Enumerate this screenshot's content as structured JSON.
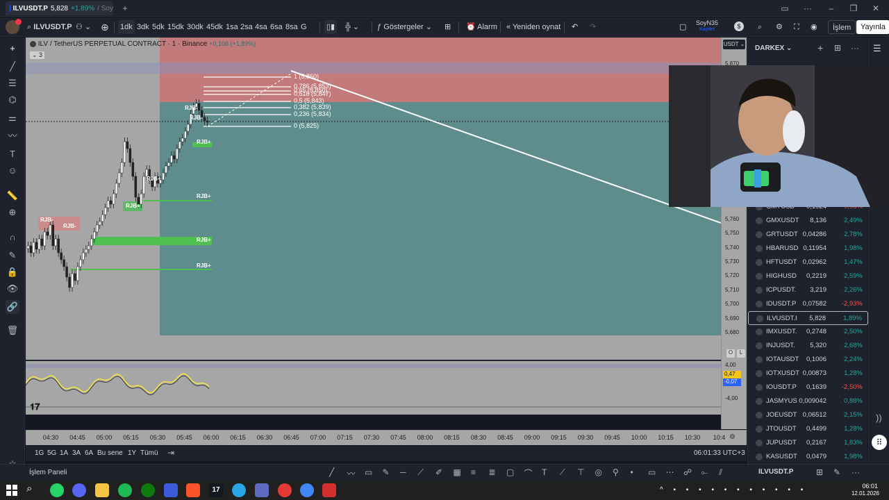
{
  "titlebar": {
    "tab_symbol": "ILVUSDT.P",
    "tab_price": "5,828",
    "tab_change": "+1.89%",
    "tab_rest": "/ Soy"
  },
  "toolbar": {
    "symbol": "ILVUSDT.P",
    "intervals": [
      "1dk",
      "3dk",
      "5dk",
      "15dk",
      "30dk",
      "45dk",
      "1sa",
      "2sa",
      "4sa",
      "6sa",
      "8sa",
      "G"
    ],
    "active_interval": "1dk",
    "indicators_label": "Göstergeler",
    "alarm_label": "Alarm",
    "replay_label": "Yeniden oynat",
    "layout_name": "SoyN35",
    "layout_saved": "Kaydet",
    "trade_label": "İşlem",
    "publish_label": "Yayınla"
  },
  "chart": {
    "legend": "ILV / TetherUS PERPETUAL CONTRACT · 1 · Binance",
    "legend_change": "+0,108 (+1,89%)",
    "legend_count": "3",
    "currency": "USDT",
    "price_ticks": [
      "5,870",
      "5,760",
      "5,750",
      "5,740",
      "5,730",
      "5,720",
      "5,710",
      "5,700",
      "5,690",
      "5,680"
    ],
    "osc_ticks": [
      "4,00",
      "-4,00"
    ],
    "osc_values": [
      "0,47",
      "-0,07"
    ],
    "time_ticks": [
      "04:30",
      "04:45",
      "05:00",
      "05:15",
      "05:30",
      "05:45",
      "06:00",
      "06:15",
      "06:30",
      "06:45",
      "07:00",
      "07:15",
      "07:30",
      "07:45",
      "08:00",
      "08:15",
      "08:30",
      "08:45",
      "09:00",
      "09:15",
      "09:30",
      "09:45",
      "10:00",
      "10:15",
      "10:30",
      "10:4"
    ],
    "fib_levels": [
      "1 (5,860)",
      "0,786 (5,853)",
      "0,65 (5,850)",
      "0,618 (5,847)",
      "0,5 (5,843)",
      "0,382 (5,839)",
      "0,236 (5,834)",
      "0 (5,825)"
    ],
    "rjb_labels": [
      "RJB+",
      "RJB+",
      "RJB+",
      "RJB+",
      "RJB-",
      "RJB-",
      "RJB-",
      "RJB+",
      "RJB+",
      "RJB-"
    ]
  },
  "bottombar": {
    "ranges": [
      "1G",
      "5G",
      "1A",
      "3A",
      "6A",
      "Bu sene",
      "1Y",
      "Tümü"
    ],
    "clock": "06:01:33 UTC+3"
  },
  "panel": {
    "label": "İşlem Paneli",
    "symbol": "ILVUSDT.P"
  },
  "watchlist": {
    "title": "DARKEX",
    "rows": [
      {
        "symbol": "GMTUSD",
        "price": "0,1924",
        "change": "-0,98%",
        "dir": "neg"
      },
      {
        "symbol": "GMXUSDT",
        "price": "8,136",
        "change": "2,49%",
        "dir": "pos"
      },
      {
        "symbol": "GRTUSDT",
        "price": "0,04286",
        "change": "2,78%",
        "dir": "pos"
      },
      {
        "symbol": "HBARUSD",
        "price": "0,11954",
        "change": "1,98%",
        "dir": "pos"
      },
      {
        "symbol": "HFTUSDT",
        "price": "0,02962",
        "change": "1,47%",
        "dir": "pos"
      },
      {
        "symbol": "HIGHUSD",
        "price": "0,2219",
        "change": "2,59%",
        "dir": "pos"
      },
      {
        "symbol": "ICPUSDT.",
        "price": "3,219",
        "change": "2,26%",
        "dir": "pos"
      },
      {
        "symbol": "IDUSDT.P",
        "price": "0,07582",
        "change": "-2,93%",
        "dir": "neg"
      },
      {
        "symbol": "ILVUSDT.I",
        "price": "5,828",
        "change": "1,89%",
        "dir": "pos"
      },
      {
        "symbol": "IMXUSDT.",
        "price": "0,2748",
        "change": "2,50%",
        "dir": "pos"
      },
      {
        "symbol": "INJUSDT.",
        "price": "5,320",
        "change": "2,68%",
        "dir": "pos"
      },
      {
        "symbol": "IOTAUSDT",
        "price": "0,1006",
        "change": "2,24%",
        "dir": "pos"
      },
      {
        "symbol": "IOTXUSDT",
        "price": "0,00873",
        "change": "1,28%",
        "dir": "pos"
      },
      {
        "symbol": "IOUSDT.P",
        "price": "0,1639",
        "change": "-2,50%",
        "dir": "neg"
      },
      {
        "symbol": "JASMYUS",
        "price": "0,009042",
        "change": "0,88%",
        "dir": "pos"
      },
      {
        "symbol": "JOEUSDT",
        "price": "0,06512",
        "change": "2,15%",
        "dir": "pos"
      },
      {
        "symbol": "JTOUSDT",
        "price": "0,4499",
        "change": "1,28%",
        "dir": "pos"
      },
      {
        "symbol": "JUPUSDT",
        "price": "0,2167",
        "change": "1,83%",
        "dir": "pos"
      },
      {
        "symbol": "KASUSDT",
        "price": "0,0479",
        "change": "1,98%",
        "dir": "pos"
      }
    ]
  },
  "taskbar": {
    "time": "06:01",
    "date": "12.01.2026"
  },
  "colors": {
    "bg": "#131722",
    "chart_bg": "#a6a6a6",
    "profit_zone": "#5f8d8d",
    "loss_zone": "#c27a7a",
    "up": "#26a69a",
    "down": "#ef5350",
    "osc_line": "#f5e642"
  }
}
